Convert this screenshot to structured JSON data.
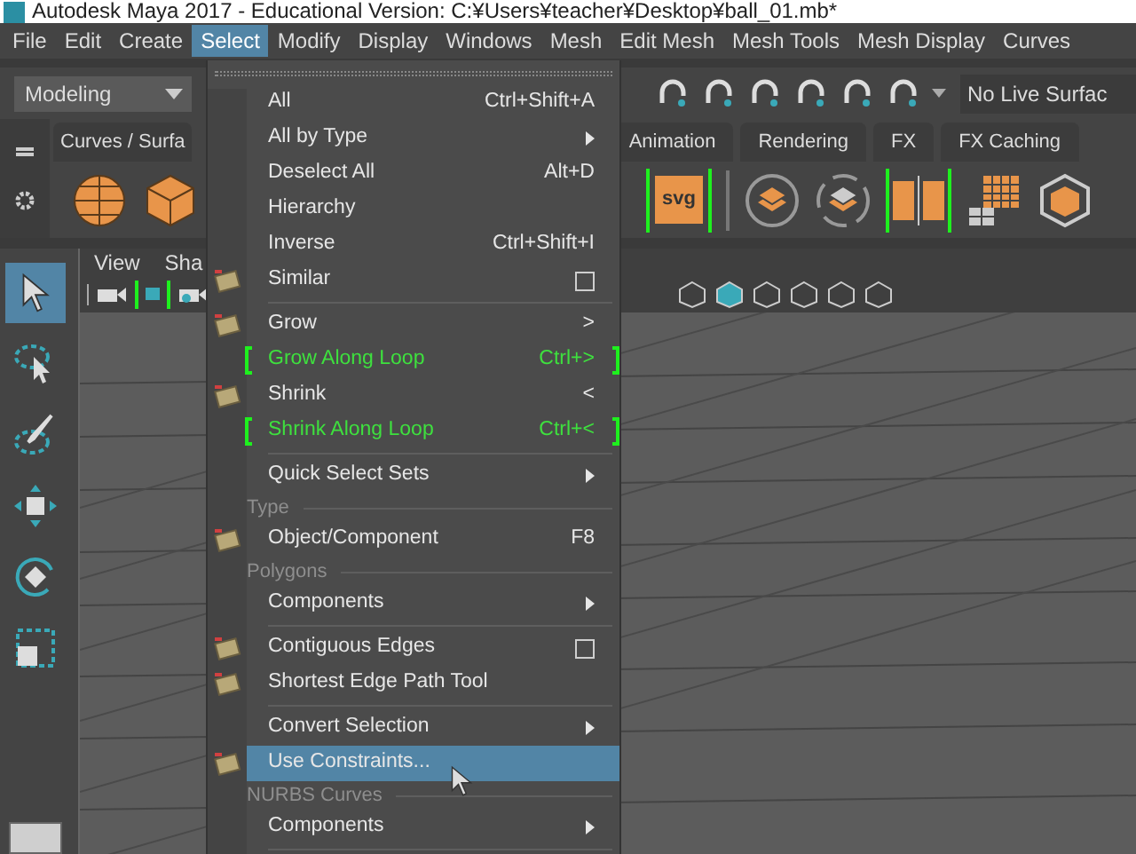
{
  "window": {
    "title": "Autodesk Maya 2017 - Educational Version: C:¥Users¥teacher¥Desktop¥ball_01.mb*"
  },
  "menubar": [
    {
      "label": "File",
      "selected": false
    },
    {
      "label": "Edit",
      "selected": false
    },
    {
      "label": "Create",
      "selected": false
    },
    {
      "label": "Select",
      "selected": true
    },
    {
      "label": "Modify",
      "selected": false
    },
    {
      "label": "Display",
      "selected": false
    },
    {
      "label": "Windows",
      "selected": false
    },
    {
      "label": "Mesh",
      "selected": false
    },
    {
      "label": "Edit Mesh",
      "selected": false
    },
    {
      "label": "Mesh Tools",
      "selected": false
    },
    {
      "label": "Mesh Display",
      "selected": false
    },
    {
      "label": "Curves",
      "selected": false
    }
  ],
  "toolbar": {
    "workspace": "Modeling",
    "live_surface": "No Live Surfac"
  },
  "shelf": {
    "svg_button": "svg",
    "tabs": [
      {
        "label": "Curves / Surfa",
        "selected": false
      },
      {
        "label": "Animation",
        "selected": false
      },
      {
        "label": "Rendering",
        "selected": false
      },
      {
        "label": "FX",
        "selected": false
      },
      {
        "label": "FX Caching",
        "selected": false
      }
    ]
  },
  "tools": [
    {
      "kind": "select",
      "selected": true
    },
    {
      "kind": "lasso",
      "selected": false
    },
    {
      "kind": "paint",
      "selected": false
    },
    {
      "kind": "move",
      "selected": false
    },
    {
      "kind": "rotate",
      "selected": false
    },
    {
      "kind": "scale",
      "selected": false
    }
  ],
  "viewport": {
    "menus": [
      "View",
      "Sha"
    ]
  },
  "select_menu": {
    "items": [
      {
        "kind": "item",
        "label": "All",
        "shortcut": "Ctrl+Shift+A",
        "submenu": false,
        "option_box": false,
        "marked": false,
        "selected": false,
        "has_icon": false
      },
      {
        "kind": "item",
        "label": "All by Type",
        "submenu": true,
        "option_box": false,
        "marked": false,
        "selected": false,
        "has_icon": false
      },
      {
        "kind": "item",
        "label": "Deselect All",
        "shortcut": "Alt+D",
        "submenu": false,
        "option_box": false,
        "marked": false,
        "selected": false,
        "has_icon": false
      },
      {
        "kind": "item",
        "label": "Hierarchy",
        "submenu": false,
        "option_box": false,
        "marked": false,
        "selected": false,
        "has_icon": false
      },
      {
        "kind": "item",
        "label": "Inverse",
        "shortcut": "Ctrl+Shift+I",
        "submenu": false,
        "option_box": false,
        "marked": false,
        "selected": false,
        "has_icon": false
      },
      {
        "kind": "item",
        "label": "Similar",
        "submenu": false,
        "option_box": true,
        "marked": false,
        "selected": false,
        "has_icon": true
      },
      {
        "kind": "divider"
      },
      {
        "kind": "item",
        "label": "Grow",
        "shortcut": ">",
        "submenu": false,
        "option_box": false,
        "marked": false,
        "selected": false,
        "has_icon": true
      },
      {
        "kind": "item",
        "label": "Grow Along Loop",
        "shortcut": "Ctrl+>",
        "submenu": false,
        "option_box": false,
        "marked": true,
        "selected": false,
        "has_icon": false
      },
      {
        "kind": "item",
        "label": "Shrink",
        "shortcut": "<",
        "submenu": false,
        "option_box": false,
        "marked": false,
        "selected": false,
        "has_icon": true
      },
      {
        "kind": "item",
        "label": "Shrink Along Loop",
        "shortcut": "Ctrl+<",
        "submenu": false,
        "option_box": false,
        "marked": true,
        "selected": false,
        "has_icon": false
      },
      {
        "kind": "divider"
      },
      {
        "kind": "item",
        "label": "Quick Select Sets",
        "submenu": true,
        "option_box": false,
        "marked": false,
        "selected": false,
        "has_icon": false
      },
      {
        "kind": "section",
        "label": "Type"
      },
      {
        "kind": "item",
        "label": "Object/Component",
        "shortcut": "F8",
        "submenu": false,
        "option_box": false,
        "marked": false,
        "selected": false,
        "has_icon": true
      },
      {
        "kind": "section",
        "label": "Polygons"
      },
      {
        "kind": "item",
        "label": "Components",
        "submenu": true,
        "option_box": false,
        "marked": false,
        "selected": false,
        "has_icon": false
      },
      {
        "kind": "divider"
      },
      {
        "kind": "item",
        "label": "Contiguous Edges",
        "submenu": false,
        "option_box": true,
        "marked": false,
        "selected": false,
        "has_icon": true
      },
      {
        "kind": "item",
        "label": "Shortest Edge Path Tool",
        "submenu": false,
        "option_box": false,
        "marked": false,
        "selected": false,
        "has_icon": true
      },
      {
        "kind": "divider"
      },
      {
        "kind": "item",
        "label": "Convert Selection",
        "submenu": true,
        "option_box": false,
        "marked": false,
        "selected": false,
        "has_icon": false
      },
      {
        "kind": "item",
        "label": "Use Constraints...",
        "submenu": false,
        "option_box": false,
        "marked": false,
        "selected": true,
        "has_icon": true
      },
      {
        "kind": "section",
        "label": "NURBS Curves"
      },
      {
        "kind": "item",
        "label": "Components",
        "submenu": true,
        "option_box": false,
        "marked": false,
        "selected": false,
        "has_icon": false
      },
      {
        "kind": "divider"
      }
    ]
  }
}
